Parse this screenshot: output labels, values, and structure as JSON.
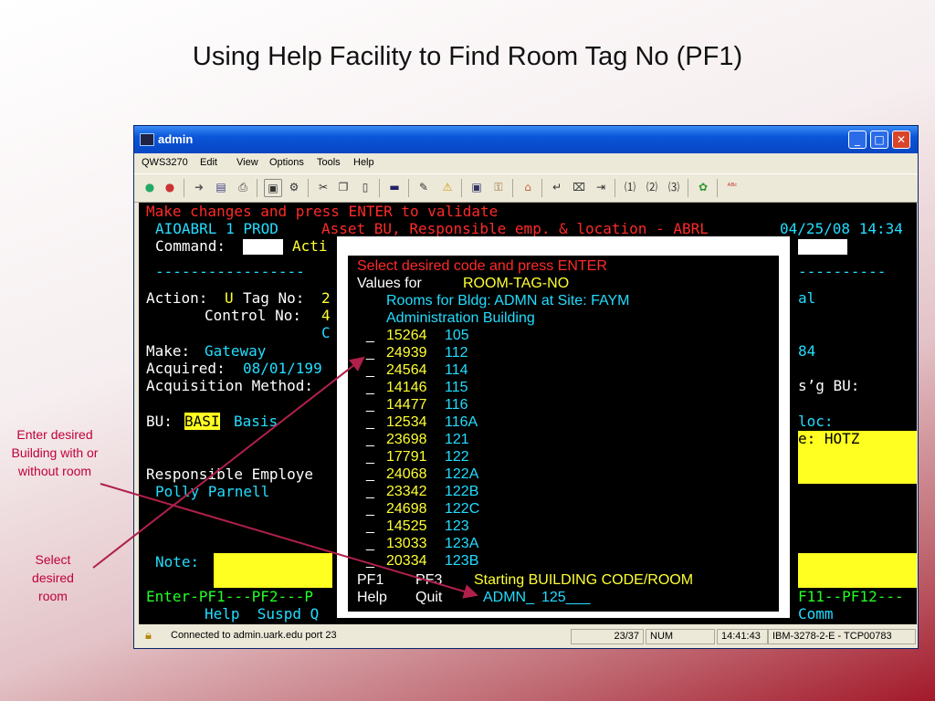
{
  "slide": {
    "title": "Using Help Facility to Find Room Tag No (PF1)",
    "note_enter": "Enter desired Building with or without room",
    "note_select": "Select desired room"
  },
  "window": {
    "title": "admin",
    "menu": [
      "QWS3270",
      "Edit",
      "View",
      "Options",
      "Tools",
      "Help"
    ]
  },
  "terminal": {
    "line0": "Make changes and press ENTER to validate",
    "line1_left": "AIOABRL 1 PROD",
    "line1_mid": "Asset BU, Responsible emp. & location - ABRL",
    "line1_right": "04/25/08 14:34",
    "command_label": "Command:",
    "command_after": "Acti",
    "dashes_left": "-----------------",
    "dashes_right": "----------",
    "action_label": "Action:",
    "action_value": "U",
    "tag_label": "Tag No:",
    "tag_value": "2",
    "control_label": "Control No:",
    "control_value": "4",
    "control_value2": "C",
    "make_label": "Make:",
    "make_value": "Gateway",
    "acquired_label": "Acquired:",
    "acquired_value": "08/01/199",
    "acq_method_label": "Acquisition Method:",
    "bu_label": "BU:",
    "bu_value": "BASI",
    "bu_desc": "Basis",
    "resp_label": "Responsible Employe",
    "resp_value": "Polly Parnell",
    "note_label": "Note:",
    "pf_line1": "Enter-PF1---PF2---P",
    "pf_line2": "Help  Suspd Q",
    "right_al": "al",
    "right_84": "84",
    "right_sg": "s’g BU:",
    "right_loc": "loc:",
    "right_e": "e: HOTZ",
    "right_pf1": "F11--PF12---",
    "right_pf2": "Comm"
  },
  "popup": {
    "instruction": "Select desired code and press ENTER",
    "values_label": "Values for",
    "values_field": "ROOM-TAG-NO",
    "bldg_line": "Rooms for Bldg: ADMN at Site: FAYM",
    "bldg_name": "Administration Building",
    "rows": [
      {
        "sel": "_",
        "tag": "15264",
        "room": "105"
      },
      {
        "sel": "_",
        "tag": "24939",
        "room": "112"
      },
      {
        "sel": "_",
        "tag": "24564",
        "room": "114"
      },
      {
        "sel": "_",
        "tag": "14146",
        "room": "115"
      },
      {
        "sel": "_",
        "tag": "14477",
        "room": "116"
      },
      {
        "sel": "_",
        "tag": "12534",
        "room": "116A"
      },
      {
        "sel": "_",
        "tag": "23698",
        "room": "121"
      },
      {
        "sel": "_",
        "tag": "17791",
        "room": "122"
      },
      {
        "sel": "_",
        "tag": "24068",
        "room": "122A"
      },
      {
        "sel": "_",
        "tag": "23342",
        "room": "122B"
      },
      {
        "sel": "_",
        "tag": "24698",
        "room": "122C"
      },
      {
        "sel": "_",
        "tag": "14525",
        "room": "123"
      },
      {
        "sel": "_",
        "tag": "13033",
        "room": "123A"
      },
      {
        "sel": "_",
        "tag": "20334",
        "room": "123B"
      }
    ],
    "pf1_key": "PF1",
    "pf3_key": "PF3",
    "starting_label": "Starting BUILDING CODE/ROOM",
    "help_label": "Help",
    "quit_label": "Quit",
    "bldg_input": "ADMN_",
    "room_input": "125___"
  },
  "status": {
    "connection": "Connected to admin.uark.edu port 23",
    "cursor": "23/37",
    "num": "NUM",
    "time": "14:41:43",
    "session": "IBM-3278-2-E - TCP00783"
  },
  "colors": {
    "accent_line": "#b0204a",
    "terminal_bg": "#000000",
    "highlight": "#ffff22"
  },
  "icons": [
    "connect-icon",
    "disconnect-icon",
    "print-icon",
    "copy-icon",
    "paste-icon",
    "warning-icon",
    "keyboard-icon",
    "home-icon",
    "macro-icon",
    "spell-check-icon"
  ]
}
